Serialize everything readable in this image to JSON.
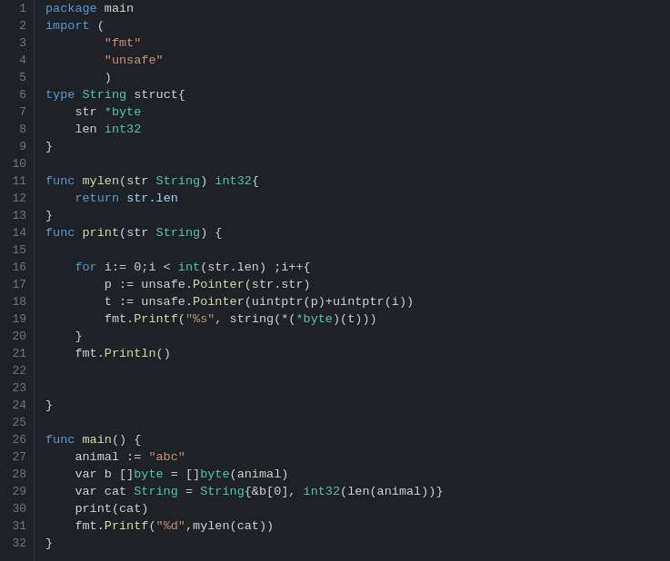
{
  "editor": {
    "background": "#1e2226",
    "lines": [
      {
        "number": 1,
        "tokens": [
          {
            "text": "package ",
            "class": "keyword-color"
          },
          {
            "text": "main",
            "class": "white"
          }
        ]
      },
      {
        "number": 2,
        "tokens": [
          {
            "text": "import",
            "class": "keyword-color"
          },
          {
            "text": " (",
            "class": "white"
          }
        ]
      },
      {
        "number": 3,
        "tokens": [
          {
            "text": "        ",
            "class": ""
          },
          {
            "text": "\"fmt\"",
            "class": "string-color"
          }
        ]
      },
      {
        "number": 4,
        "tokens": [
          {
            "text": "        ",
            "class": ""
          },
          {
            "text": "\"unsafe\"",
            "class": "string-color"
          }
        ]
      },
      {
        "number": 5,
        "tokens": [
          {
            "text": "        )",
            "class": "white"
          }
        ]
      },
      {
        "number": 6,
        "tokens": [
          {
            "text": "type ",
            "class": "keyword-color"
          },
          {
            "text": "String",
            "class": "type-color"
          },
          {
            "text": " struct{",
            "class": "white"
          }
        ]
      },
      {
        "number": 7,
        "tokens": [
          {
            "text": "    str ",
            "class": "white"
          },
          {
            "text": "*byte",
            "class": "type-color"
          }
        ]
      },
      {
        "number": 8,
        "tokens": [
          {
            "text": "    len ",
            "class": "white"
          },
          {
            "text": "int32",
            "class": "type-color"
          }
        ]
      },
      {
        "number": 9,
        "tokens": [
          {
            "text": "}",
            "class": "white"
          }
        ]
      },
      {
        "number": 10,
        "tokens": []
      },
      {
        "number": 11,
        "tokens": [
          {
            "text": "func ",
            "class": "keyword-color"
          },
          {
            "text": "mylen",
            "class": "func-color"
          },
          {
            "text": "(str ",
            "class": "white"
          },
          {
            "text": "String",
            "class": "type-color"
          },
          {
            "text": ") ",
            "class": "white"
          },
          {
            "text": "int32",
            "class": "type-color"
          },
          {
            "text": "{",
            "class": "white"
          }
        ]
      },
      {
        "number": 12,
        "tokens": [
          {
            "text": "    return ",
            "class": "keyword-color"
          },
          {
            "text": "str.len",
            "class": "var-color"
          }
        ]
      },
      {
        "number": 13,
        "tokens": [
          {
            "text": "}",
            "class": "white"
          }
        ]
      },
      {
        "number": 14,
        "tokens": [
          {
            "text": "func ",
            "class": "keyword-color"
          },
          {
            "text": "print",
            "class": "func-color"
          },
          {
            "text": "(str ",
            "class": "white"
          },
          {
            "text": "String",
            "class": "type-color"
          },
          {
            "text": ") {",
            "class": "white"
          }
        ]
      },
      {
        "number": 15,
        "tokens": []
      },
      {
        "number": 16,
        "tokens": [
          {
            "text": "    for ",
            "class": "keyword-color"
          },
          {
            "text": "i:= 0;i < ",
            "class": "white"
          },
          {
            "text": "int",
            "class": "type-color"
          },
          {
            "text": "(str.len) ;i++{",
            "class": "white"
          }
        ]
      },
      {
        "number": 17,
        "tokens": [
          {
            "text": "        p := unsafe.",
            "class": "white"
          },
          {
            "text": "Pointer",
            "class": "func-color"
          },
          {
            "text": "(str.str)",
            "class": "white"
          }
        ]
      },
      {
        "number": 18,
        "tokens": [
          {
            "text": "        t := unsafe.",
            "class": "white"
          },
          {
            "text": "Pointer",
            "class": "func-color"
          },
          {
            "text": "(uintptr(p)+uintptr(i))",
            "class": "white"
          }
        ]
      },
      {
        "number": 19,
        "tokens": [
          {
            "text": "        fmt.",
            "class": "white"
          },
          {
            "text": "Printf",
            "class": "func-color"
          },
          {
            "text": "(",
            "class": "white"
          },
          {
            "text": "\"%s\"",
            "class": "string-color"
          },
          {
            "text": ", string(*(",
            "class": "white"
          },
          {
            "text": "*byte",
            "class": "type-color"
          },
          {
            "text": ")(t)))",
            "class": "white"
          }
        ]
      },
      {
        "number": 20,
        "tokens": [
          {
            "text": "    }",
            "class": "white"
          }
        ]
      },
      {
        "number": 21,
        "tokens": [
          {
            "text": "    fmt.",
            "class": "white"
          },
          {
            "text": "Println",
            "class": "func-color"
          },
          {
            "text": "()",
            "class": "white"
          }
        ]
      },
      {
        "number": 22,
        "tokens": []
      },
      {
        "number": 23,
        "tokens": []
      },
      {
        "number": 24,
        "tokens": [
          {
            "text": "}",
            "class": "white"
          }
        ]
      },
      {
        "number": 25,
        "tokens": []
      },
      {
        "number": 26,
        "tokens": [
          {
            "text": "func ",
            "class": "keyword-color"
          },
          {
            "text": "main",
            "class": "func-color"
          },
          {
            "text": "() {",
            "class": "white"
          }
        ]
      },
      {
        "number": 27,
        "tokens": [
          {
            "text": "    animal := ",
            "class": "white"
          },
          {
            "text": "\"abc\"",
            "class": "string-color"
          }
        ]
      },
      {
        "number": 28,
        "tokens": [
          {
            "text": "    var b []",
            "class": "white"
          },
          {
            "text": "byte",
            "class": "type-color"
          },
          {
            "text": " = []",
            "class": "white"
          },
          {
            "text": "byte",
            "class": "type-color"
          },
          {
            "text": "(animal)",
            "class": "white"
          }
        ]
      },
      {
        "number": 29,
        "tokens": [
          {
            "text": "    var cat ",
            "class": "white"
          },
          {
            "text": "String",
            "class": "type-color"
          },
          {
            "text": " = ",
            "class": "white"
          },
          {
            "text": "String",
            "class": "type-color"
          },
          {
            "text": "{&b[0], ",
            "class": "white"
          },
          {
            "text": "int32",
            "class": "type-color"
          },
          {
            "text": "(len(animal))}",
            "class": "white"
          }
        ]
      },
      {
        "number": 30,
        "tokens": [
          {
            "text": "    print(cat)",
            "class": "white"
          }
        ]
      },
      {
        "number": 31,
        "tokens": [
          {
            "text": "    fmt.",
            "class": "white"
          },
          {
            "text": "Printf",
            "class": "func-color"
          },
          {
            "text": "(",
            "class": "white"
          },
          {
            "text": "\"%d\"",
            "class": "string-color"
          },
          {
            "text": ",mylen(cat))",
            "class": "white"
          }
        ]
      },
      {
        "number": 32,
        "tokens": [
          {
            "text": "}",
            "class": "white"
          }
        ]
      }
    ]
  }
}
